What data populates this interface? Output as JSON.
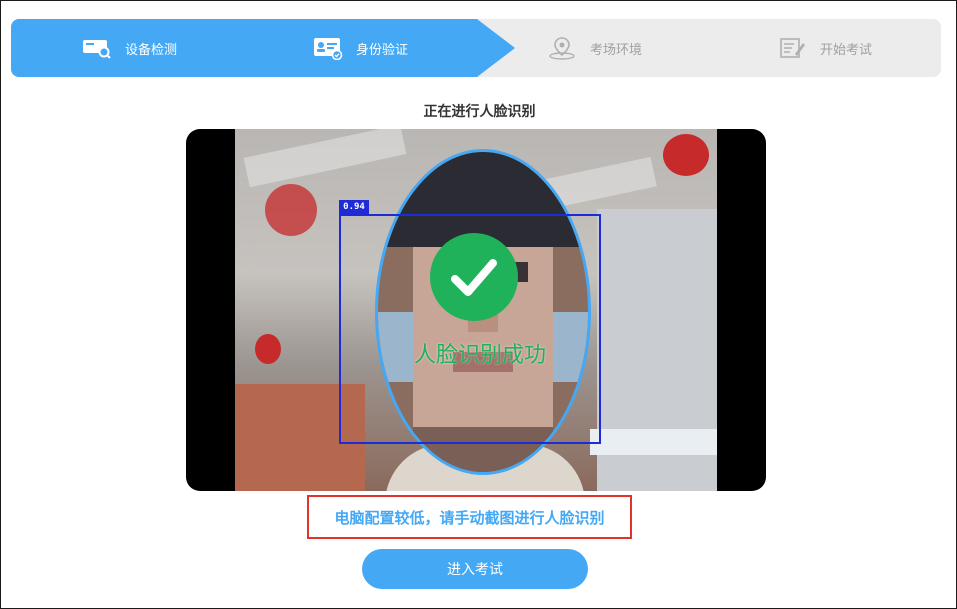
{
  "stepper": {
    "steps": [
      {
        "label": "设备检测",
        "icon": "device-check-icon",
        "state": "done"
      },
      {
        "label": "身份验证",
        "icon": "id-card-icon",
        "state": "active"
      },
      {
        "label": "考场环境",
        "icon": "location-pin-icon",
        "state": "pending"
      },
      {
        "label": "开始考试",
        "icon": "exam-sheet-icon",
        "state": "pending"
      }
    ],
    "active_color": "#45a8f5",
    "inactive_color": "#ececec"
  },
  "main": {
    "title": "正在进行人脸识别",
    "video": {
      "detection_score": "0.94",
      "overlay_text": "人脸识别成功",
      "success_color": "#1fb25a",
      "box_color": "#1f2bd6"
    },
    "notice": "电脑配置较低，请手动截图进行人脸识别",
    "notice_border_color": "#e0342b",
    "enter_button_label": "进入考试"
  }
}
